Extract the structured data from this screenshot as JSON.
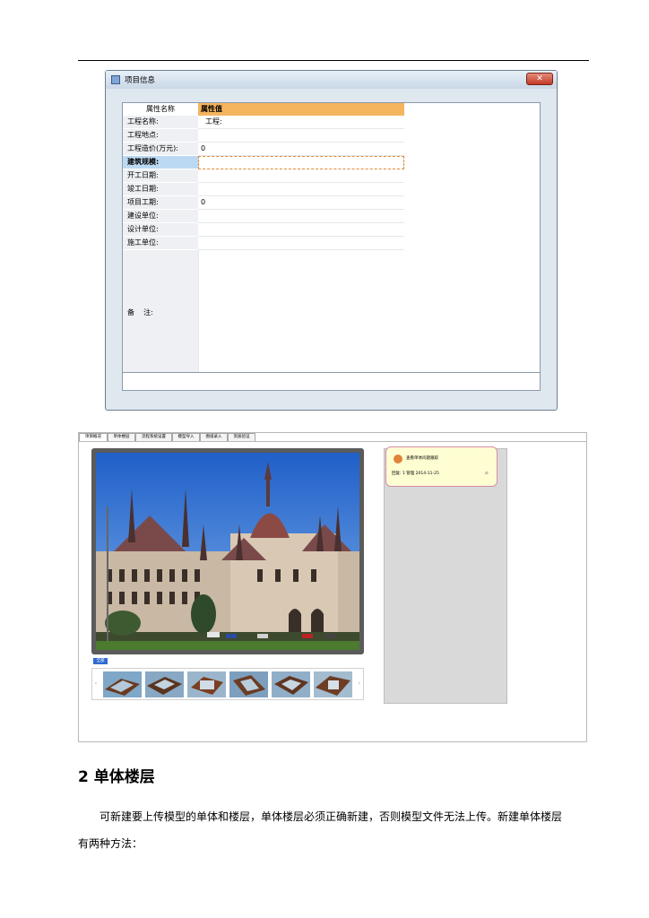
{
  "dialog": {
    "title": "项目信息",
    "close_label": "✕",
    "header_name": "属性名称",
    "header_value": "属性值",
    "rows": [
      {
        "name": "工程名称:",
        "value": "工程:"
      },
      {
        "name": "工程地点:",
        "value": ""
      },
      {
        "name": "工程造价(万元):",
        "value": "0"
      },
      {
        "name": "建筑规模:",
        "value": ""
      },
      {
        "name": "开工日期:",
        "value": ""
      },
      {
        "name": "竣工日期:",
        "value": ""
      },
      {
        "name": "项目工期:",
        "value": "0"
      },
      {
        "name": "建设单位:",
        "value": ""
      },
      {
        "name": "设计单位:",
        "value": ""
      },
      {
        "name": "施工单位:",
        "value": ""
      }
    ],
    "remark_label": "备    注:"
  },
  "panel": {
    "tabs": [
      "项目概况",
      "单体楼层",
      "流程系统设置",
      "模型导入",
      "图纸录入",
      "资质验证"
    ],
    "thumb_label": "全部",
    "note": {
      "title": "查看单体问题跟踪",
      "meta": "回复: 1  管理    2014-11-25"
    }
  },
  "doc": {
    "heading": "2 单体楼层",
    "para_line1": "可新建要上传模型的单体和楼层，单体楼层必须正确新建，否则模型文件无法上传。新建单体楼层",
    "para_line2": "有两种方法："
  }
}
